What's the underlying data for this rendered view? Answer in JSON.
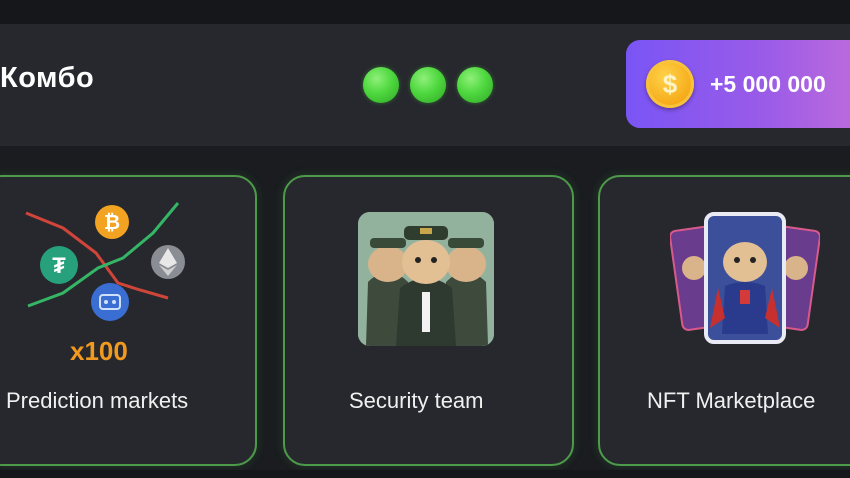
{
  "combo": {
    "title": "Комбо",
    "found_count": 3,
    "reward": "+5 000 000",
    "coin_icon": "coin-icon",
    "dot_color": "#4fd83f",
    "pill_gradient": [
      "#7a55f5",
      "#c46ed9"
    ]
  },
  "cards": [
    {
      "label": "Prediction markets",
      "badge": "x100",
      "icon": "crypto-prediction-icon"
    },
    {
      "label": "Security team",
      "icon": "security-hamsters-image"
    },
    {
      "label": "NFT Marketplace",
      "icon": "nft-cards-image"
    }
  ]
}
